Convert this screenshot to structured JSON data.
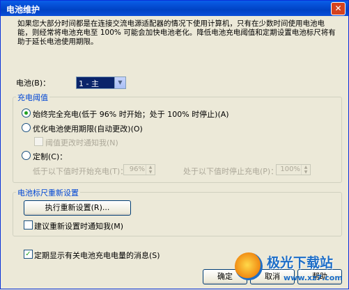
{
  "window": {
    "title": "电池维护",
    "close_glyph": "✕"
  },
  "description": "如果您大部分时间都是在连接交流电源适配器的情况下使用计算机，只有在少数时间使用电池电能，则经常将电池充电至 100% 可能会加快电池老化。降低电池充电阈值和定期设置电池标尺将有助于延长电池使用期限。",
  "battery": {
    "label": "电池(B)：",
    "selected": "1 - 主"
  },
  "threshold_group": {
    "title": "充电阈值",
    "full_charge": {
      "label": "始终完全充电(低于 96% 时开始；处于 100% 时停止)(A)",
      "selected": true
    },
    "optimize": {
      "label": "优化电池使用期限(自动更改)(O)",
      "selected": false
    },
    "notify_threshold": {
      "label": "阈值更改时通知我(N)",
      "checked": false,
      "enabled": false
    },
    "custom": {
      "label": "定制(C)：",
      "selected": false
    },
    "start_label": "低于以下值时开始充电(T)：",
    "start_value": "96%",
    "stop_label": "处于以下值时停止充电(P)：",
    "stop_value": "100%"
  },
  "calibration_group": {
    "title": "电池标尺重新设置",
    "run_button": "执行重新设置(R)...",
    "notify_reset": {
      "label": "建议重新设置时通知我(M)",
      "checked": false
    }
  },
  "periodic_message": {
    "label": "定期显示有关电池充电电量的消息(S)",
    "checked": true
  },
  "buttons": {
    "ok": "确定",
    "cancel": "取消",
    "help": "帮助"
  },
  "watermark": {
    "line1": "极光下载站",
    "line2": "www.xz7.com"
  },
  "colors": {
    "titlebar": "#0054e3",
    "accent": "#0046d5",
    "check": "#21a121",
    "dialog_bg": "#ece9d8"
  }
}
